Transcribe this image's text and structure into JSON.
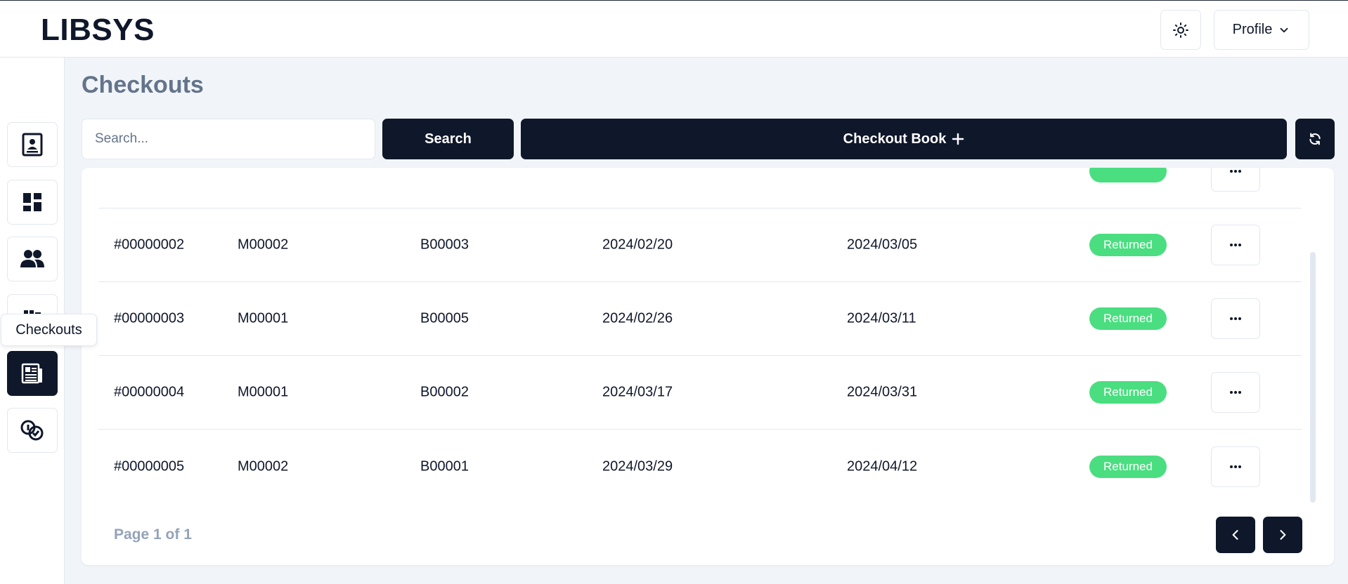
{
  "app": {
    "logo": "LIBSYS"
  },
  "header": {
    "profile_label": "Profile"
  },
  "sidebar": {
    "items": [
      {
        "name": "contacts",
        "icon": "id-card-icon"
      },
      {
        "name": "dashboard",
        "icon": "dashboard-icon"
      },
      {
        "name": "members",
        "icon": "users-icon"
      },
      {
        "name": "books",
        "icon": "books-icon"
      },
      {
        "name": "checkouts",
        "icon": "newspaper-icon",
        "active": true
      },
      {
        "name": "fines",
        "icon": "coins-icon"
      }
    ],
    "tooltip": "Checkouts"
  },
  "main": {
    "title": "Checkouts",
    "search": {
      "placeholder": "Search...",
      "value": ""
    },
    "search_label": "Search",
    "checkout_label": "Checkout Book",
    "rows": [
      {
        "id": "",
        "member": "",
        "book": "",
        "checkout_date": "",
        "due_date": "",
        "status": ""
      },
      {
        "id": "#00000002",
        "member": "M00002",
        "book": "B00003",
        "checkout_date": "2024/02/20",
        "due_date": "2024/03/05",
        "status": "Returned"
      },
      {
        "id": "#00000003",
        "member": "M00001",
        "book": "B00005",
        "checkout_date": "2024/02/26",
        "due_date": "2024/03/11",
        "status": "Returned"
      },
      {
        "id": "#00000004",
        "member": "M00001",
        "book": "B00002",
        "checkout_date": "2024/03/17",
        "due_date": "2024/03/31",
        "status": "Returned"
      },
      {
        "id": "#00000005",
        "member": "M00002",
        "book": "B00001",
        "checkout_date": "2024/03/29",
        "due_date": "2024/04/12",
        "status": "Returned"
      }
    ],
    "pagination": {
      "label": "Page 1 of 1"
    }
  },
  "colors": {
    "primary": "#0f172a",
    "badge_returned": "#4ade80",
    "background": "#f1f5f9"
  }
}
